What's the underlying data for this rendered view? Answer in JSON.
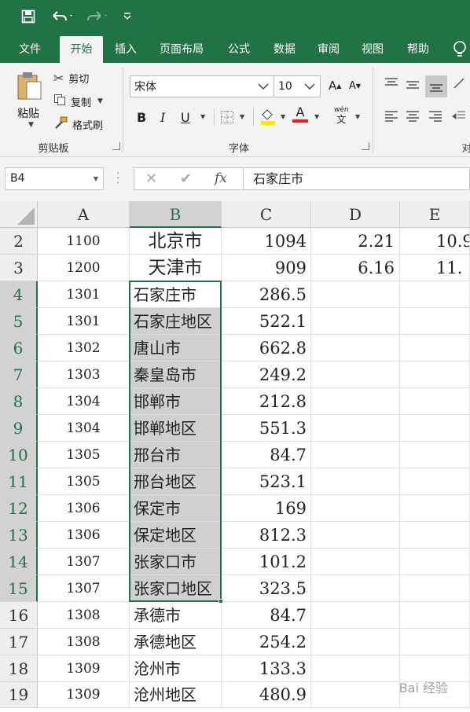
{
  "quick_access": {
    "save_icon": "save-icon",
    "undo_icon": "undo-icon",
    "redo_icon": "redo-icon",
    "customize_icon": "customize-icon"
  },
  "tabs": [
    "文件",
    "开始",
    "插入",
    "页面布局",
    "公式",
    "数据",
    "审阅",
    "视图",
    "帮助"
  ],
  "active_tab": "开始",
  "ribbon": {
    "clipboard": {
      "paste": "粘贴",
      "cut": "剪切",
      "copy": "复制",
      "format_painter": "格式刷",
      "label": "剪贴板"
    },
    "font": {
      "name": "宋体",
      "size": "10",
      "label": "字体",
      "bold": "B",
      "italic": "I",
      "underline": "U",
      "phonetic_top": "wén",
      "phonetic_bottom": "文",
      "grow": "A",
      "shrink": "A",
      "font_color": "A"
    },
    "alignment_label": "对"
  },
  "formula_bar": {
    "name_box": "B4",
    "fx": "fx",
    "content": "石家庄市"
  },
  "columns": [
    "A",
    "B",
    "C",
    "D",
    "E"
  ],
  "selected_column": "B",
  "rows": [
    {
      "num": "2",
      "a": "1100",
      "b": "北京市",
      "c": "1094",
      "d": "2.21",
      "e": "10.9"
    },
    {
      "num": "3",
      "a": "1200",
      "b": "天津市",
      "c": "909",
      "d": "6.16",
      "e": "11."
    },
    {
      "num": "4",
      "a": "1301",
      "b": "石家庄市",
      "c": "286.5",
      "d": "",
      "e": ""
    },
    {
      "num": "5",
      "a": "1301",
      "b": "石家庄地区",
      "c": "522.1",
      "d": "",
      "e": ""
    },
    {
      "num": "6",
      "a": "1302",
      "b": "唐山市",
      "c": "662.8",
      "d": "",
      "e": ""
    },
    {
      "num": "7",
      "a": "1303",
      "b": "秦皇岛市",
      "c": "249.2",
      "d": "",
      "e": ""
    },
    {
      "num": "8",
      "a": "1304",
      "b": "邯郸市",
      "c": "212.8",
      "d": "",
      "e": ""
    },
    {
      "num": "9",
      "a": "1304",
      "b": "邯郸地区",
      "c": "551.3",
      "d": "",
      "e": ""
    },
    {
      "num": "10",
      "a": "1305",
      "b": "邢台市",
      "c": "84.7",
      "d": "",
      "e": ""
    },
    {
      "num": "11",
      "a": "1305",
      "b": "邢台地区",
      "c": "523.1",
      "d": "",
      "e": ""
    },
    {
      "num": "12",
      "a": "1306",
      "b": "保定市",
      "c": "169",
      "d": "",
      "e": ""
    },
    {
      "num": "13",
      "a": "1306",
      "b": "保定地区",
      "c": "812.3",
      "d": "",
      "e": ""
    },
    {
      "num": "14",
      "a": "1307",
      "b": "张家口市",
      "c": "101.2",
      "d": "",
      "e": ""
    },
    {
      "num": "15",
      "a": "1307",
      "b": "张家口地区",
      "c": "323.5",
      "d": "",
      "e": ""
    },
    {
      "num": "16",
      "a": "1308",
      "b": "承德市",
      "c": "84.7",
      "d": "",
      "e": ""
    },
    {
      "num": "17",
      "a": "1308",
      "b": "承德地区",
      "c": "254.2",
      "d": "",
      "e": ""
    },
    {
      "num": "18",
      "a": "1309",
      "b": "沧州市",
      "c": "133.3",
      "d": "",
      "e": ""
    },
    {
      "num": "19",
      "a": "1309",
      "b": "沧州地区",
      "c": "480.9",
      "d": "",
      "e": ""
    }
  ],
  "selection": {
    "start_row": "4",
    "end_row": "15",
    "column": "B"
  },
  "watermark": "Bai 经验",
  "colors": {
    "accent": "#217346",
    "selected_fill": "#d0d0d0",
    "ribbon_bg": "#f3f3f3"
  }
}
